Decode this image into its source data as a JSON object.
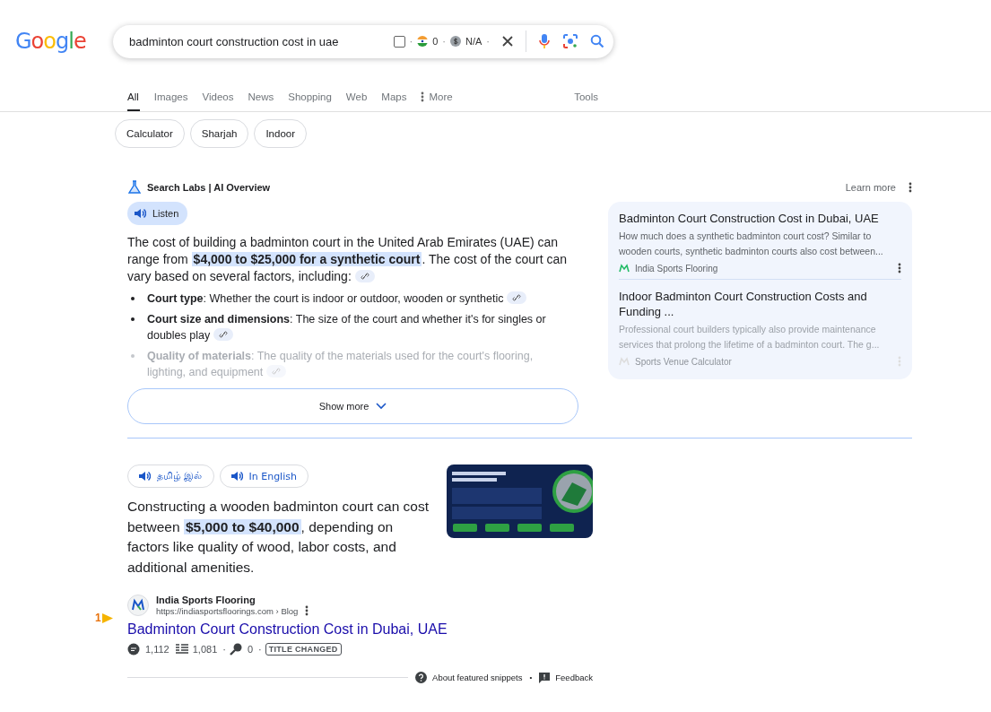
{
  "logo": "Google",
  "search": {
    "value": "badminton court construction cost in uae",
    "checked": false,
    "flag_count": "0",
    "price": "N/A",
    "separator": "·"
  },
  "tabs": [
    {
      "label": "All",
      "selected": true,
      "kind": "plain"
    },
    {
      "label": "Images",
      "selected": false,
      "kind": "plain"
    },
    {
      "label": "Videos",
      "selected": false,
      "kind": "plain"
    },
    {
      "label": "News",
      "selected": false,
      "kind": "plain"
    },
    {
      "label": "Shopping",
      "selected": false,
      "kind": "plain"
    },
    {
      "label": "Web",
      "selected": false,
      "kind": "plain"
    },
    {
      "label": "Maps",
      "selected": false,
      "kind": "plain"
    },
    {
      "label": "More",
      "selected": false,
      "kind": "more"
    }
  ],
  "tools": "Tools",
  "chips": [
    "Calculator",
    "Sharjah",
    "Indoor"
  ],
  "ai_overview": {
    "title": "Search Labs | AI Overview",
    "learn_more": "Learn more",
    "listen": "Listen",
    "paragraph": {
      "before": "The cost of building a badminton court in the United Arab Emirates (UAE) can range from ",
      "highlight": "$4,000 to $25,000 for a synthetic court",
      "after": ". The cost of the court can vary based on several factors, including:"
    },
    "bullets": [
      {
        "term": "Court type",
        "text": ": Whether the court is indoor or outdoor, wooden or synthetic",
        "faded": false
      },
      {
        "term": "Court size and dimensions",
        "text": ": The size of the court and whether it's for singles or doubles play",
        "faded": false
      },
      {
        "term": "Quality of materials",
        "text": ": The quality of the materials used for the court's flooring, lighting, and equipment",
        "faded": true
      }
    ],
    "sources": [
      {
        "title": "Badminton Court Construction Cost in Dubai, UAE",
        "snippet": "How much does a synthetic badminton court cost? Similar to wooden courts, synthetic badminton courts also cost between...",
        "site": "India Sports Flooring",
        "faded": false
      },
      {
        "title": "Indoor Badminton Court Construction Costs and Funding ...",
        "snippet": "Professional court builders typically also provide maintenance services that prolong the lifetime of a badminton court. The g...",
        "site": "Sports Venue Calculator",
        "faded": true
      }
    ],
    "show_more": "Show more"
  },
  "snippet": {
    "languages": [
      "தமிழ் இல்",
      "In English"
    ],
    "paragraph": {
      "before": "Constructing a wooden badminton court can cost between ",
      "highlight": "$5,000 to $40,000",
      "after": ", depending on factors like quality of wood, labor costs, and additional amenities."
    },
    "image": {
      "kind": "picture"
    },
    "result": {
      "rank": "1",
      "site": "India Sports Flooring",
      "url": "https://indiasportsfloorings.com › Blog",
      "title": "Badminton Court Construction Cost in Dubai, UAE",
      "stats": [
        "1,112",
        "1,081",
        "0"
      ],
      "separator": "·",
      "badge": "TITLE CHANGED"
    },
    "about": "About featured snippets",
    "footer_separator": "•",
    "feedback": "Feedback"
  }
}
